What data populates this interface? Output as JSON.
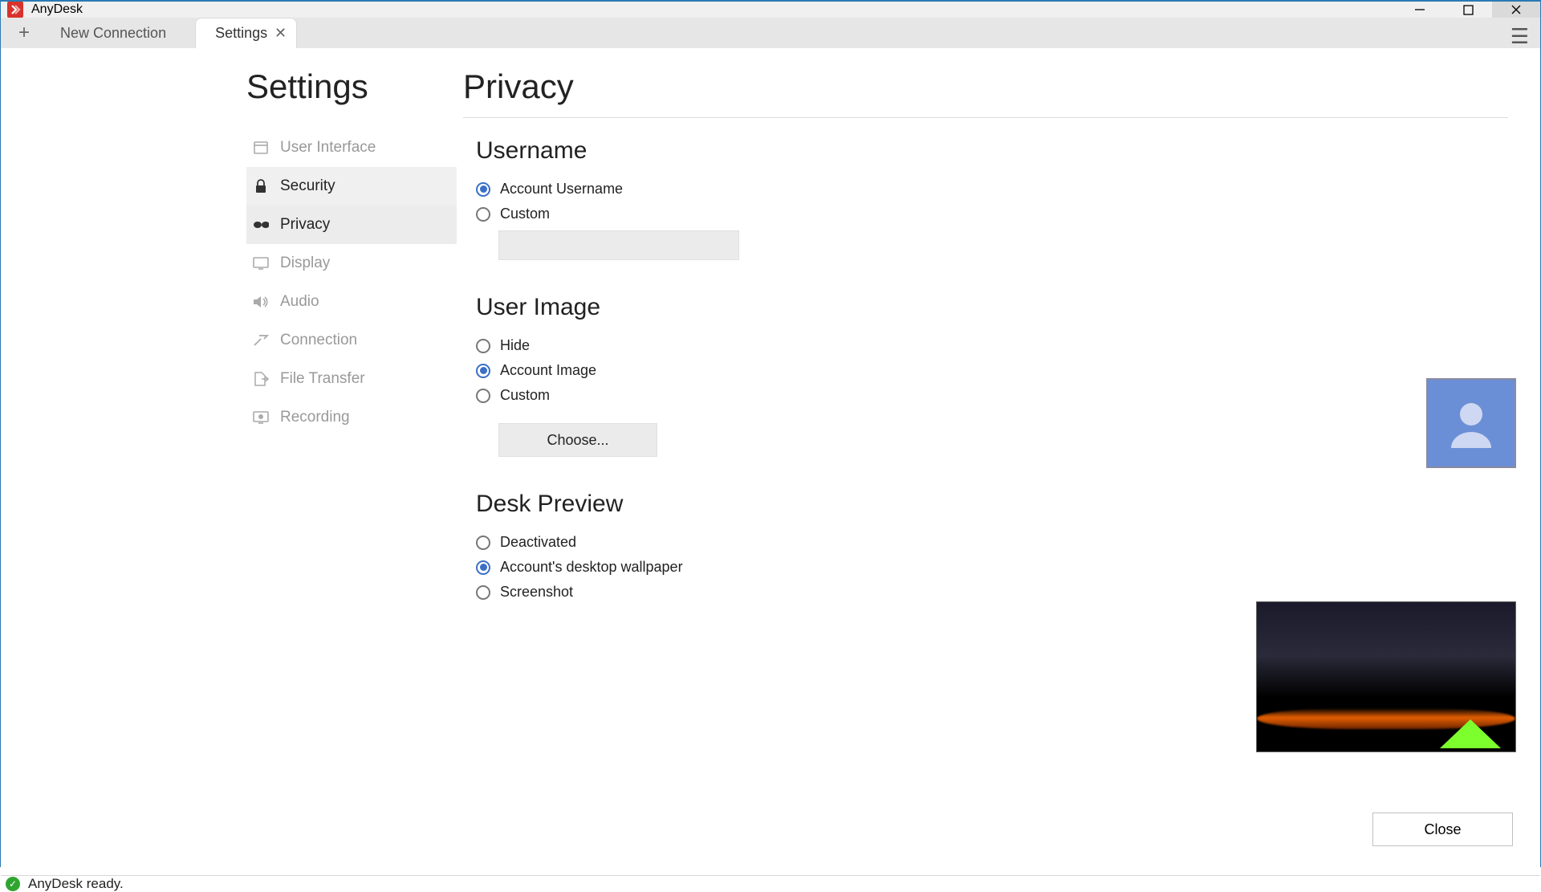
{
  "window": {
    "title": "AnyDesk"
  },
  "tabs": {
    "new_conn": "New Connection",
    "settings": "Settings"
  },
  "sidebar": {
    "heading": "Settings",
    "items": [
      {
        "label": "User Interface",
        "icon": "ui-icon"
      },
      {
        "label": "Security",
        "icon": "lock-icon"
      },
      {
        "label": "Privacy",
        "icon": "glasses-icon"
      },
      {
        "label": "Display",
        "icon": "display-icon"
      },
      {
        "label": "Audio",
        "icon": "audio-icon"
      },
      {
        "label": "Connection",
        "icon": "connection-icon"
      },
      {
        "label": "File Transfer",
        "icon": "file-transfer-icon"
      },
      {
        "label": "Recording",
        "icon": "recording-icon"
      }
    ]
  },
  "main": {
    "heading": "Privacy",
    "username": {
      "heading": "Username",
      "options": [
        "Account Username",
        "Custom"
      ],
      "selected": 0
    },
    "user_image": {
      "heading": "User Image",
      "options": [
        "Hide",
        "Account Image",
        "Custom"
      ],
      "selected": 1,
      "choose_label": "Choose..."
    },
    "desk_preview": {
      "heading": "Desk Preview",
      "options": [
        "Deactivated",
        "Account's desktop wallpaper",
        "Screenshot"
      ],
      "selected": 1
    },
    "close_label": "Close"
  },
  "status": {
    "text": "AnyDesk ready."
  }
}
